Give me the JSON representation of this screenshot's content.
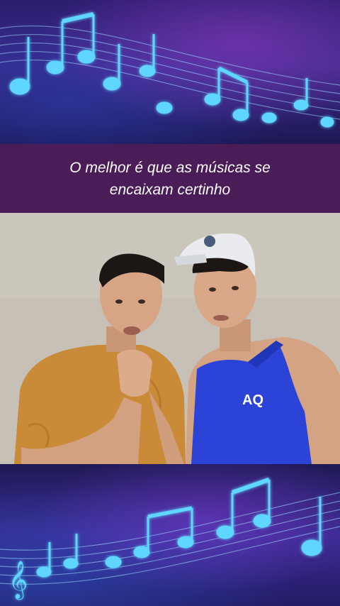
{
  "caption": {
    "text": "O melhor é que as músicas se encaixam certinho"
  },
  "top_banner": {
    "icon": "music-staff-notes"
  },
  "bottom_banner": {
    "icon": "music-staff-notes-treble-clef"
  },
  "video": {
    "shirt_logo": "AQ",
    "content": "two-young-men-singing"
  },
  "colors": {
    "caption_bg": "#4b1d58",
    "banner_dark": "#1d1853",
    "note_glow": "#5fd6ff"
  }
}
